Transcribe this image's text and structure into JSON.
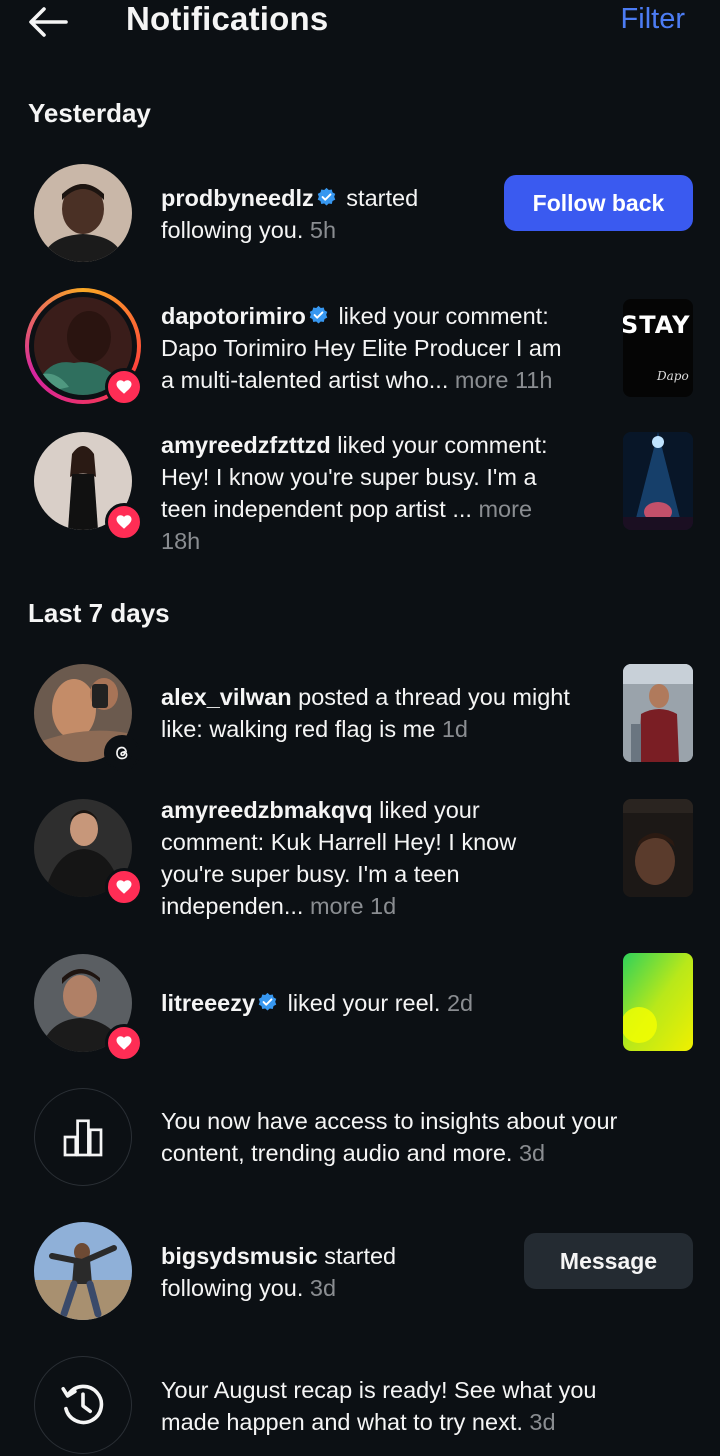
{
  "header": {
    "title": "Notifications",
    "filter_label": "Filter"
  },
  "sections": {
    "yesterday": "Yesterday",
    "last7": "Last 7 days"
  },
  "notifications": [
    {
      "username": "prodbyneedlz",
      "verified": true,
      "action": " started following you.",
      "action_line1": "started",
      "action_line2": "following you.",
      "time": "5h",
      "button": "Follow back"
    },
    {
      "username": "dapotorimiro",
      "verified": true,
      "action_line1": "liked your comment:",
      "line2": "Dapo Torimiro  Hey Elite Producer I am",
      "line3": "a multi-talented artist who...",
      "more": "more",
      "time": "11h",
      "thumb_text": "STAY",
      "thumb_sub": "Dapo"
    },
    {
      "username": "amyreedzfzttzd",
      "action_line1": "liked your comment:",
      "line2": "Hey! I know you're super busy. I'm a",
      "line3": "teen independent pop artist ...",
      "more": "more",
      "time": "18h"
    },
    {
      "username": "alex_vilwan",
      "action_line1": "posted a thread you might",
      "line2": "like: walking red flag is me",
      "time": "1d"
    },
    {
      "username": "amyreedzbmakqvq",
      "action_line1": "liked your",
      "line2": "comment: Kuk Harrell Hey! I know",
      "line3": "you're super busy. I'm a teen",
      "line4": "independen...",
      "more": "more",
      "time": "1d"
    },
    {
      "username": "litreeezy",
      "verified": true,
      "action_line1": "liked your reel.",
      "time": "2d"
    },
    {
      "line1": "You now have access to insights about your",
      "line2": "content, trending audio and more.",
      "time": "3d"
    },
    {
      "username": "bigsydsmusic",
      "action_line1": "started",
      "line2": "following you.",
      "time": "3d",
      "button": "Message"
    },
    {
      "line1": "Your August recap is ready! See what you",
      "line2": "made happen and what to try next.",
      "time": "3d"
    }
  ],
  "colors": {
    "background": "#0c1014",
    "accent": "#3a5af0",
    "filter": "#4c7cf4",
    "like_badge": "#ff2d55",
    "verified": "#3797f0"
  }
}
